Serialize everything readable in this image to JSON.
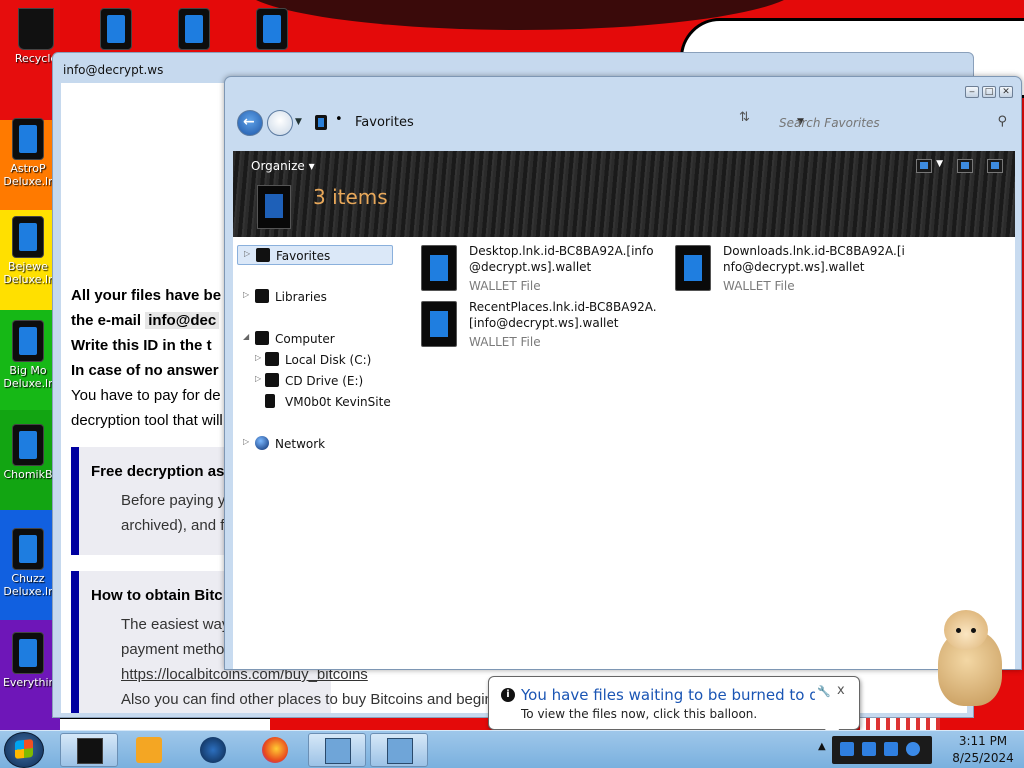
{
  "desktop": {
    "icons": [
      {
        "label": "Recycle"
      },
      {
        "label": "AstroP Deluxe.lr"
      },
      {
        "label": "Bejewe Deluxe.lr"
      },
      {
        "label": "Big Mo Deluxe.lr"
      },
      {
        "label": "ChomikB"
      },
      {
        "label": "Chuzz Deluxe.lr"
      },
      {
        "label": "Everythir"
      }
    ]
  },
  "note_window": {
    "title": "info@decrypt.ws",
    "lines": [
      "All your files have be",
      "the e-mail",
      "info@dec",
      "Write this ID in the t",
      "In case of no answer",
      "You have to pay for de",
      "decryption tool that will"
    ],
    "card1": {
      "title": "Free decryption as",
      "text1": "Before paying y",
      "text2": "archived), and f"
    },
    "card2": {
      "title": "How to obtain Bitc",
      "text1": "The easiest way",
      "text2": "payment metho",
      "link": "https://localbitcoins.com/buy_bitcoins",
      "text3": "Also you can find other places to buy Bitcoins and beginn"
    }
  },
  "explorer": {
    "address": {
      "location": "Favorites",
      "separator": "•"
    },
    "search": {
      "placeholder": "Search Favorites"
    },
    "toolbar": {
      "organize": "Organize ▾"
    },
    "header": {
      "items_count": "3 items"
    },
    "nav": {
      "favorites": "Favorites",
      "libraries": "Libraries",
      "computer": "Computer",
      "local_disk": "Local Disk (C:)",
      "cd_drive": "CD Drive (E:)",
      "vm_site": "VM0b0t KevinSite",
      "network": "Network"
    },
    "files": [
      {
        "name": "Desktop.lnk.id-BC8BA92A.[info@decrypt.ws].wallet",
        "type": "WALLET File"
      },
      {
        "name": "Downloads.lnk.id-BC8BA92A.[info@decrypt.ws].wallet",
        "type": "WALLET File"
      },
      {
        "name": "RecentPlaces.lnk.id-BC8BA92A.[info@decrypt.ws].wallet",
        "type": "WALLET File"
      }
    ]
  },
  "balloon": {
    "title": "You have files waiting to be burned to disc",
    "text": "To view the files now, click this balloon.",
    "close": "x"
  },
  "taskbar": {
    "clock_time": "3:11 PM",
    "clock_date": "8/25/2024"
  },
  "colors": {
    "wallpaper_red": "#e40a0a",
    "explorer_frame": "#c8dbf0",
    "link_blue": "#1a4fd6",
    "balloon_title": "#1a55b4",
    "items_count": "#e8a85a"
  }
}
